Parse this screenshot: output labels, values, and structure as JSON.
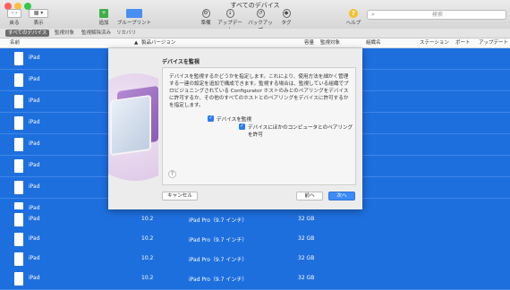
{
  "window": {
    "title": "すべてのデバイス"
  },
  "toolbar": {
    "back_label": "戻る",
    "view_label": "表示",
    "add_label": "追加",
    "blueprint_label": "ブループリント",
    "prepare_label": "準備",
    "update_label": "アップデート",
    "backup_label": "バックアップ",
    "tag_label": "タグ",
    "help_label": "ヘルプ",
    "search_placeholder": "検索"
  },
  "tabs": [
    "すべてのデバイス",
    "監視対象",
    "監視解除済み",
    "リカバリ"
  ],
  "columns": {
    "name": "名前",
    "version": "製品バージョン",
    "capacity": "容量",
    "supervised": "監視対象",
    "org": "組織名",
    "station": "ステーション",
    "port": "ポート",
    "update": "アップデート"
  },
  "rows": [
    {
      "name": "iPad",
      "version": "",
      "model": "",
      "capacity": ""
    },
    {
      "name": "iPad",
      "version": "",
      "model": "",
      "capacity": ""
    },
    {
      "name": "iPad",
      "version": "",
      "model": "",
      "capacity": ""
    },
    {
      "name": "iPad",
      "version": "",
      "model": "",
      "capacity": ""
    },
    {
      "name": "iPad",
      "version": "",
      "model": "",
      "capacity": ""
    },
    {
      "name": "iPad",
      "version": "",
      "model": "",
      "capacity": ""
    },
    {
      "name": "iPad",
      "version": "",
      "model": "",
      "capacity": ""
    },
    {
      "name": "iPad",
      "version": "",
      "model": "",
      "capacity": ""
    },
    {
      "name": "iPad",
      "version": "10.2",
      "model": "iPad Pro（9.7 インチ）",
      "capacity": "32 GB"
    },
    {
      "name": "iPad",
      "version": "10.2",
      "model": "iPad Pro（9.7 インチ）",
      "capacity": "32 GB"
    },
    {
      "name": "iPad",
      "version": "10.2",
      "model": "iPad Pro（9.7 インチ）",
      "capacity": "32 GB"
    },
    {
      "name": "iPad",
      "version": "10.2",
      "model": "iPad Pro（9.7 インチ）",
      "capacity": "32 GB"
    }
  ],
  "dialog": {
    "title": "デバイスを監視",
    "description": "デバイスを監視するかどうかを指定します。これにより、使用方法を細かく管理する一連の設定を追加で構成できます。監視する場合は、監視している組織でプロビジョニングされている Configurator ホストのみとのペアリングをデバイスに許可するか、その他のすべてのホストとのペアリングをデバイスに許可するかを指定します。",
    "supervise_label": "デバイスを監視",
    "allow_pairing_label": "デバイスにほかのコンピュータとのペアリングを許可",
    "cancel_label": "キャンセル",
    "prev_label": "前へ",
    "next_label": "次へ"
  },
  "colors": {
    "selection": "#1e6fde",
    "accent": "#3b8cf6"
  }
}
